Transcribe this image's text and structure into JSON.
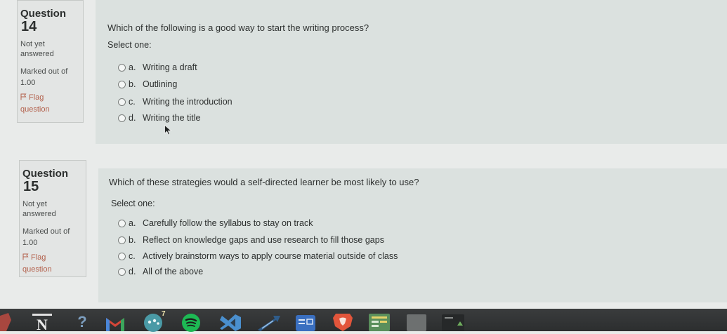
{
  "colors": {
    "page_bg": "#e9ebea",
    "content_bg": "#dbe1df",
    "info_bg": "#e3e5e4",
    "flag_link": "#b3614c",
    "taskbar_bg": "#323435"
  },
  "questions": [
    {
      "label": "Question",
      "number": "14",
      "status": "Not yet answered",
      "marks": "Marked out of 1.00",
      "flag": "Flag question",
      "text": "Which of the following is a good way to start the writing process?",
      "prompt": "Select one:",
      "options": [
        {
          "letter": "a.",
          "text": "Writing a draft",
          "selected": false
        },
        {
          "letter": "b.",
          "text": "Outlining",
          "selected": false
        },
        {
          "letter": "c.",
          "text": "Writing the introduction",
          "selected": false
        },
        {
          "letter": "d.",
          "text": "Writing the title",
          "selected": false
        }
      ]
    },
    {
      "label": "Question",
      "number": "15",
      "status": "Not yet answered",
      "marks": "Marked out of 1.00",
      "flag": "Flag question",
      "text": "Which of these strategies would a self-directed learner be most likely to use?",
      "prompt": "Select one:",
      "options": [
        {
          "letter": "a.",
          "text": "Carefully follow the syllabus to stay on track",
          "selected": false
        },
        {
          "letter": "b.",
          "text": "Reflect on knowledge gaps and use research to fill those gaps",
          "selected": false
        },
        {
          "letter": "c.",
          "text": "Actively brainstorm ways to apply course material outside of class",
          "selected": false
        },
        {
          "letter": "d.",
          "text": "All of the above",
          "selected": false
        }
      ]
    }
  ],
  "cursor": {
    "icon": "mouse-cursor-icon"
  },
  "taskbar": {
    "icons": [
      {
        "name": "partial-app-icon"
      },
      {
        "name": "notion-icon",
        "glyph": "N"
      },
      {
        "name": "help-icon",
        "glyph": "?"
      },
      {
        "name": "gmail-icon"
      },
      {
        "name": "chat-app-icon",
        "badge": "7"
      },
      {
        "name": "spotify-icon"
      },
      {
        "name": "vscode-icon"
      },
      {
        "name": "arrow-app-icon"
      },
      {
        "name": "blue-app-icon"
      },
      {
        "name": "brave-icon"
      },
      {
        "name": "sheets-icon"
      },
      {
        "name": "window-icon"
      },
      {
        "name": "dark-app-icon"
      }
    ]
  }
}
